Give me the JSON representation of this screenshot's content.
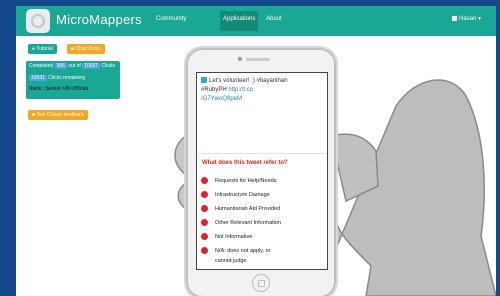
{
  "navbar": {
    "brand": "MicroMappers",
    "links": [
      {
        "label": "Community"
      },
      {
        "label": "Applications"
      },
      {
        "label": "About"
      }
    ],
    "user": "Hasan"
  },
  "sidebar": {
    "tutorial_button": "Tutorial",
    "chat_button": "Chat Room",
    "stats": {
      "completed_prefix": "Completed",
      "completed_count": "306",
      "completed_mid": "out of",
      "total": "10037",
      "completed_suffix": "Clicks",
      "remaining_count": "10031",
      "remaining_suffix": "Clicks remaining",
      "rank": "Rank : Senior UN Official"
    },
    "feedback_button": "Text Clicker feedback"
  },
  "phone": {
    "tweet_line1": "Let's volunteer! :) #bayanihan",
    "tweet_line2": "#RubyPH",
    "tweet_link1": "http://t.co",
    "tweet_link2": "/G7YwoQ8peM",
    "question": "What does this tweet refer to?",
    "options": [
      {
        "label": "Requests for Help/Needs"
      },
      {
        "label": "Infrastructure Damage"
      },
      {
        "label": "Humanitarian Aid Provided"
      },
      {
        "label": "Other Relevant Information"
      },
      {
        "label": "Not Informative"
      },
      {
        "label": "N/A: does not apply, or"
      },
      {
        "label": "cannot judge"
      }
    ]
  },
  "colors": {
    "accent_teal": "#1aa894",
    "accent_orange": "#f5a623",
    "option_dot": "#d7262e",
    "question_red": "#d22c1c",
    "border_blue": "#16498c"
  }
}
